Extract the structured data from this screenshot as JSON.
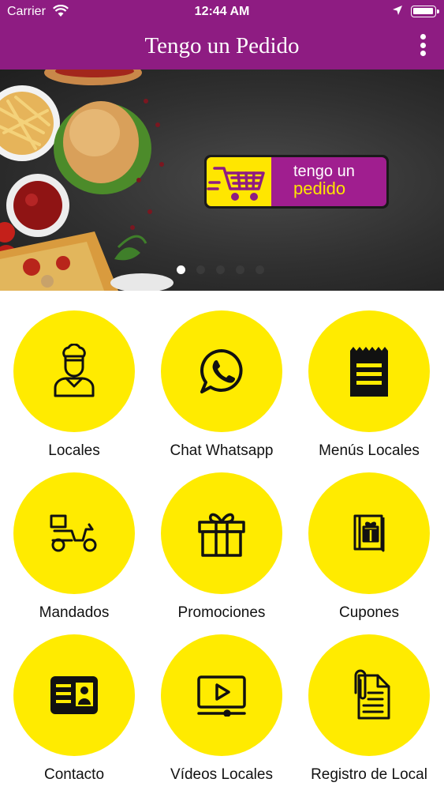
{
  "status_bar": {
    "carrier": "Carrier",
    "time": "12:44 AM"
  },
  "nav": {
    "title": "Tengo un Pedido",
    "menu_icon": "kebab-menu-icon"
  },
  "banner": {
    "logo_line1": "tengo un",
    "logo_line2": "pedido",
    "slides": 5,
    "active_slide": 1
  },
  "menu": [
    {
      "label": "Locales",
      "icon": "chef-icon"
    },
    {
      "label": "Chat Whatsapp",
      "icon": "whatsapp-icon"
    },
    {
      "label": "Menús Locales",
      "icon": "menu-notepad-icon"
    },
    {
      "label": "Mandados",
      "icon": "delivery-scooter-icon"
    },
    {
      "label": "Promociones",
      "icon": "gift-icon"
    },
    {
      "label": "Cupones",
      "icon": "coupon-book-icon"
    },
    {
      "label": "Contacto",
      "icon": "contact-card-icon"
    },
    {
      "label": "Vídeos Locales",
      "icon": "video-player-icon"
    },
    {
      "label": "Registro de Local",
      "icon": "document-clip-icon"
    }
  ],
  "colors": {
    "brand": "#8e1c82",
    "accent": "#ffeb00"
  }
}
